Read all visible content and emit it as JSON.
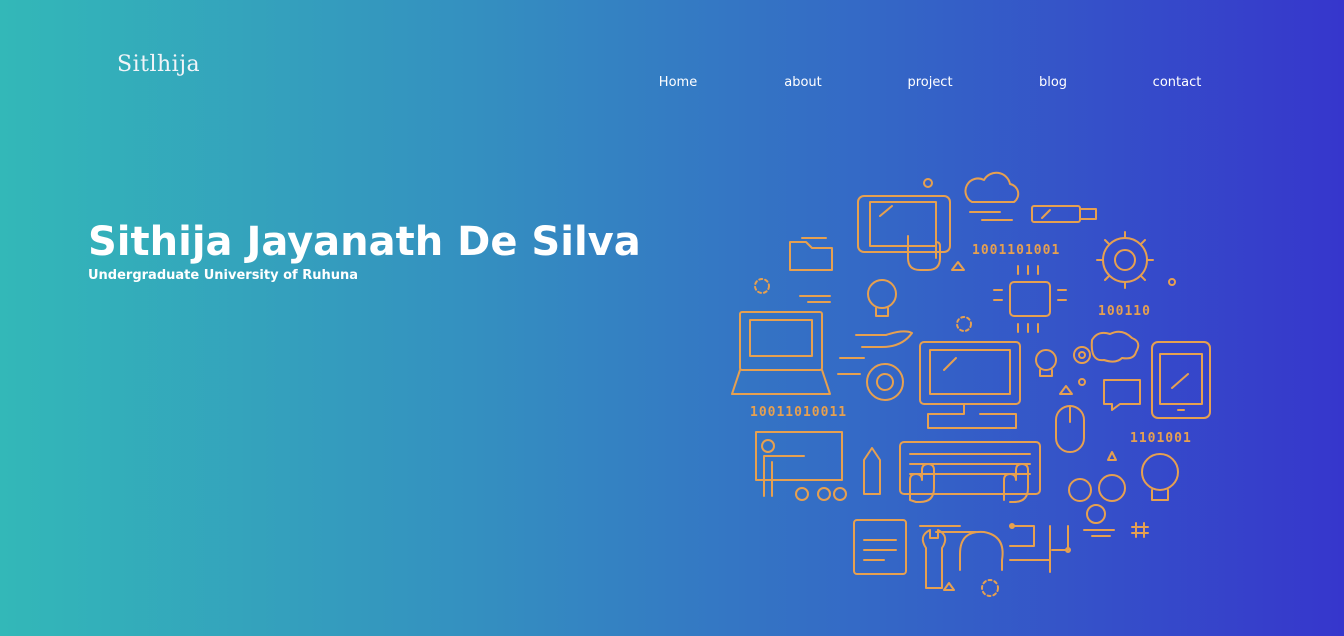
{
  "brand": {
    "logo_text": "Sitlhija"
  },
  "nav": {
    "items": [
      {
        "label": "Home"
      },
      {
        "label": "about"
      },
      {
        "label": "project"
      },
      {
        "label": "blog"
      },
      {
        "label": "contact"
      }
    ]
  },
  "hero": {
    "title": "Sithija Jayanath De Silva",
    "subtitle": "Undergraduate University of Ruhuna"
  },
  "illustration": {
    "icon": "technology-icons-circle-illustration",
    "stroke_color": "#e6a050",
    "binary_texts": [
      "10011010011",
      "100110",
      "1001101001",
      "1101001",
      "10011010011"
    ]
  },
  "theme": {
    "gradient_start": "#33b8b8",
    "gradient_end": "#3636cc",
    "text_color": "#ffffff"
  }
}
